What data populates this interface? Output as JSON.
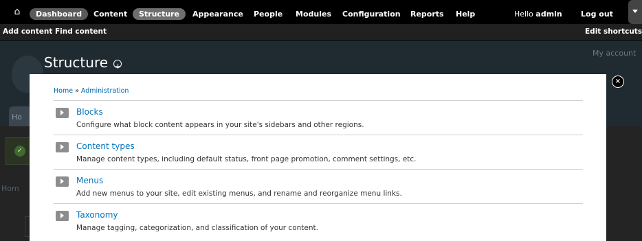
{
  "toolbar": {
    "home_icon": "home-icon",
    "items": [
      {
        "label": "Dashboard"
      },
      {
        "label": "Content"
      },
      {
        "label": "Structure"
      },
      {
        "label": "Appearance"
      },
      {
        "label": "People"
      },
      {
        "label": "Modules"
      },
      {
        "label": "Configuration"
      },
      {
        "label": "Reports"
      },
      {
        "label": "Help"
      }
    ],
    "greeting_prefix": "Hello ",
    "greeting_user": "admin",
    "logout": "Log out"
  },
  "shortcuts": {
    "add_content": "Add content",
    "find_content": "Find content",
    "edit_shortcuts": "Edit shortcuts"
  },
  "background_page": {
    "title": "Structure",
    "my_account": "My account",
    "tab_label": "Ho",
    "home_text": "Hom"
  },
  "overlay": {
    "breadcrumb": {
      "home": "Home",
      "separator": " » ",
      "current": "Administration"
    },
    "items": [
      {
        "title": "Blocks",
        "description": "Configure what block content appears in your site's sidebars and other regions."
      },
      {
        "title": "Content types",
        "description": "Manage content types, including default status, front page promotion, comment settings, etc."
      },
      {
        "title": "Menus",
        "description": "Add new menus to your site, edit existing menus, and rename and reorganize menu links."
      },
      {
        "title": "Taxonomy",
        "description": "Manage tagging, categorization, and classification of your content."
      }
    ],
    "close_label": "×"
  },
  "colors": {
    "toolbar_bg": "#000000",
    "link": "#0074bd",
    "pill": "#5a5a5a"
  }
}
